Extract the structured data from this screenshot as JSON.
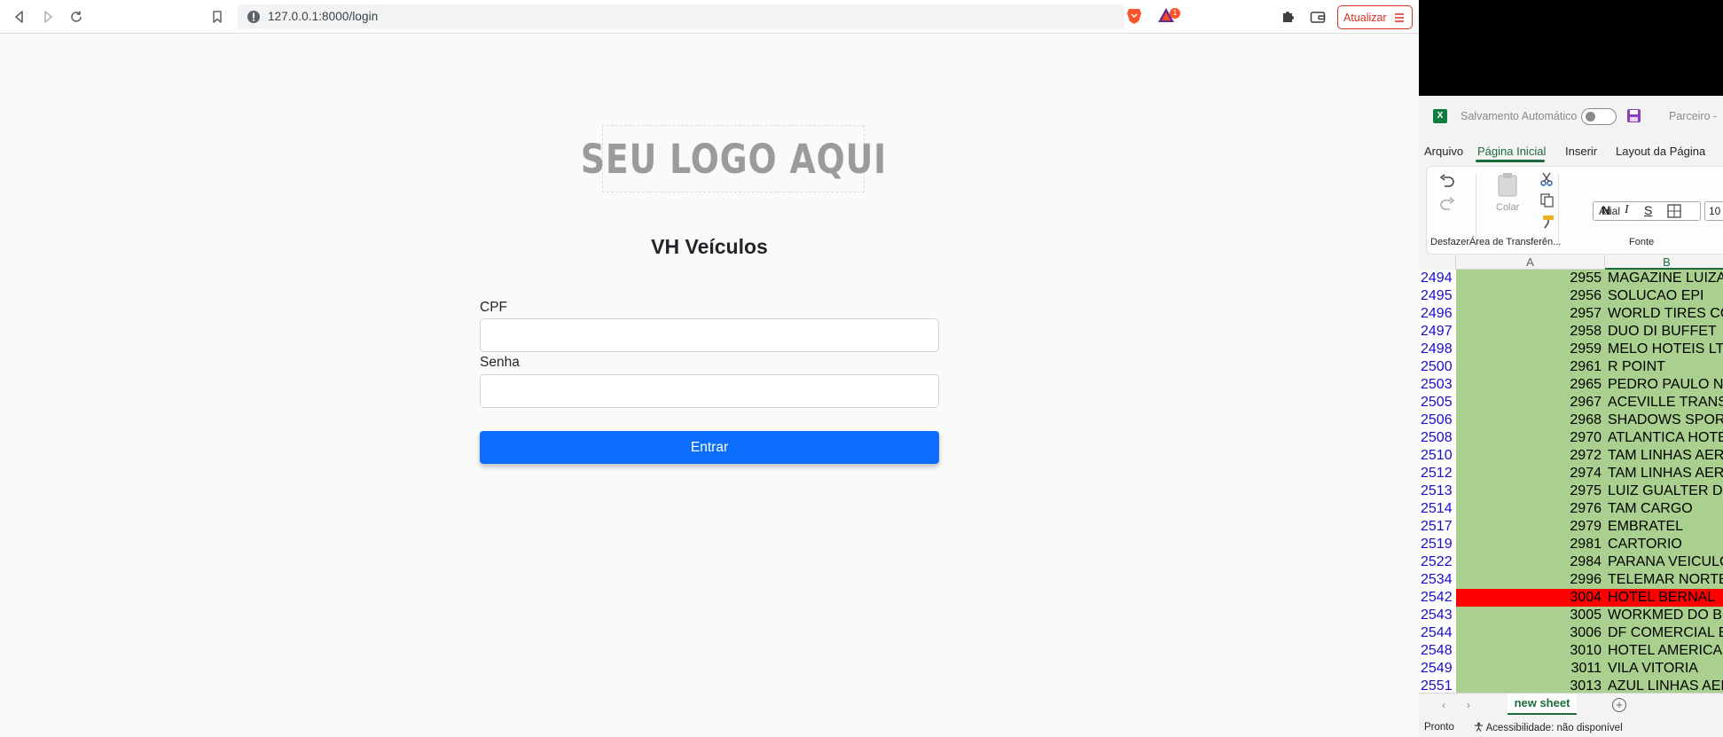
{
  "browser": {
    "url": "127.0.0.1:8000/login",
    "rewards_badge": "1",
    "update_label": "Atualizar"
  },
  "page": {
    "logo_text": "SEU LOGO AQUI",
    "title": "VH Veículos",
    "cpf_label": "CPF",
    "cpf_value": "",
    "password_label": "Senha",
    "password_value": "",
    "submit_label": "Entrar",
    "colors": {
      "primary": "#0d6efd",
      "text": "#212529"
    }
  },
  "excel": {
    "autosave_label": "Salvamento Automático",
    "doc_title": "Parceiro -",
    "tabs": [
      "Arquivo",
      "Página Inicial",
      "Inserir",
      "Layout da Página"
    ],
    "active_tab": "Página Inicial",
    "groups": {
      "undo": "Desfazer",
      "clipboard": "Área de Transferên...",
      "font": "Fonte"
    },
    "paste_label": "Colar",
    "font_name": "Arial",
    "font_size": "10",
    "format_buttons": {
      "bold": "N",
      "italic": "I",
      "underline": "S"
    },
    "columns": [
      "A",
      "B"
    ],
    "rows": [
      {
        "row": "2494",
        "code": "2955",
        "name": "MAGAZINE LUIZA"
      },
      {
        "row": "2495",
        "code": "2956",
        "name": "SOLUCAO EPI"
      },
      {
        "row": "2496",
        "code": "2957",
        "name": "WORLD TIRES CO"
      },
      {
        "row": "2497",
        "code": "2958",
        "name": "DUO DI BUFFET"
      },
      {
        "row": "2498",
        "code": "2959",
        "name": "MELO HOTEIS LT"
      },
      {
        "row": "2500",
        "code": "2961",
        "name": "R POINT"
      },
      {
        "row": "2503",
        "code": "2965",
        "name": "PEDRO PAULO N"
      },
      {
        "row": "2505",
        "code": "2967",
        "name": "ACEVILLE TRANS"
      },
      {
        "row": "2506",
        "code": "2968",
        "name": "SHADOWS SPOR"
      },
      {
        "row": "2508",
        "code": "2970",
        "name": "ATLANTICA HOTE"
      },
      {
        "row": "2510",
        "code": "2972",
        "name": "TAM LINHAS AER"
      },
      {
        "row": "2512",
        "code": "2974",
        "name": "TAM LINHAS AER"
      },
      {
        "row": "2513",
        "code": "2975",
        "name": "LUIZ GUALTER DI"
      },
      {
        "row": "2514",
        "code": "2976",
        "name": "TAM CARGO"
      },
      {
        "row": "2517",
        "code": "2979",
        "name": "EMBRATEL"
      },
      {
        "row": "2519",
        "code": "2981",
        "name": "CARTORIO"
      },
      {
        "row": "2522",
        "code": "2984",
        "name": "PARANA VEICULO"
      },
      {
        "row": "2534",
        "code": "2996",
        "name": "TELEMAR NORTE"
      },
      {
        "row": "2542",
        "code": "3004",
        "name": "HOTEL BERNAL",
        "highlight": true
      },
      {
        "row": "2543",
        "code": "3005",
        "name": "WORKMED DO B"
      },
      {
        "row": "2544",
        "code": "3006",
        "name": "DF COMERCIAL E"
      },
      {
        "row": "2548",
        "code": "3010",
        "name": "HOTEL AMERICA"
      },
      {
        "row": "2549",
        "code": "3011",
        "name": "VILA VITORIA"
      },
      {
        "row": "2551",
        "code": "3013",
        "name": "AZUL LINHAS AER"
      }
    ],
    "sheet_name": "new sheet",
    "status_ready": "Pronto",
    "status_accessibility": "Acessibilidade: não disponível"
  }
}
